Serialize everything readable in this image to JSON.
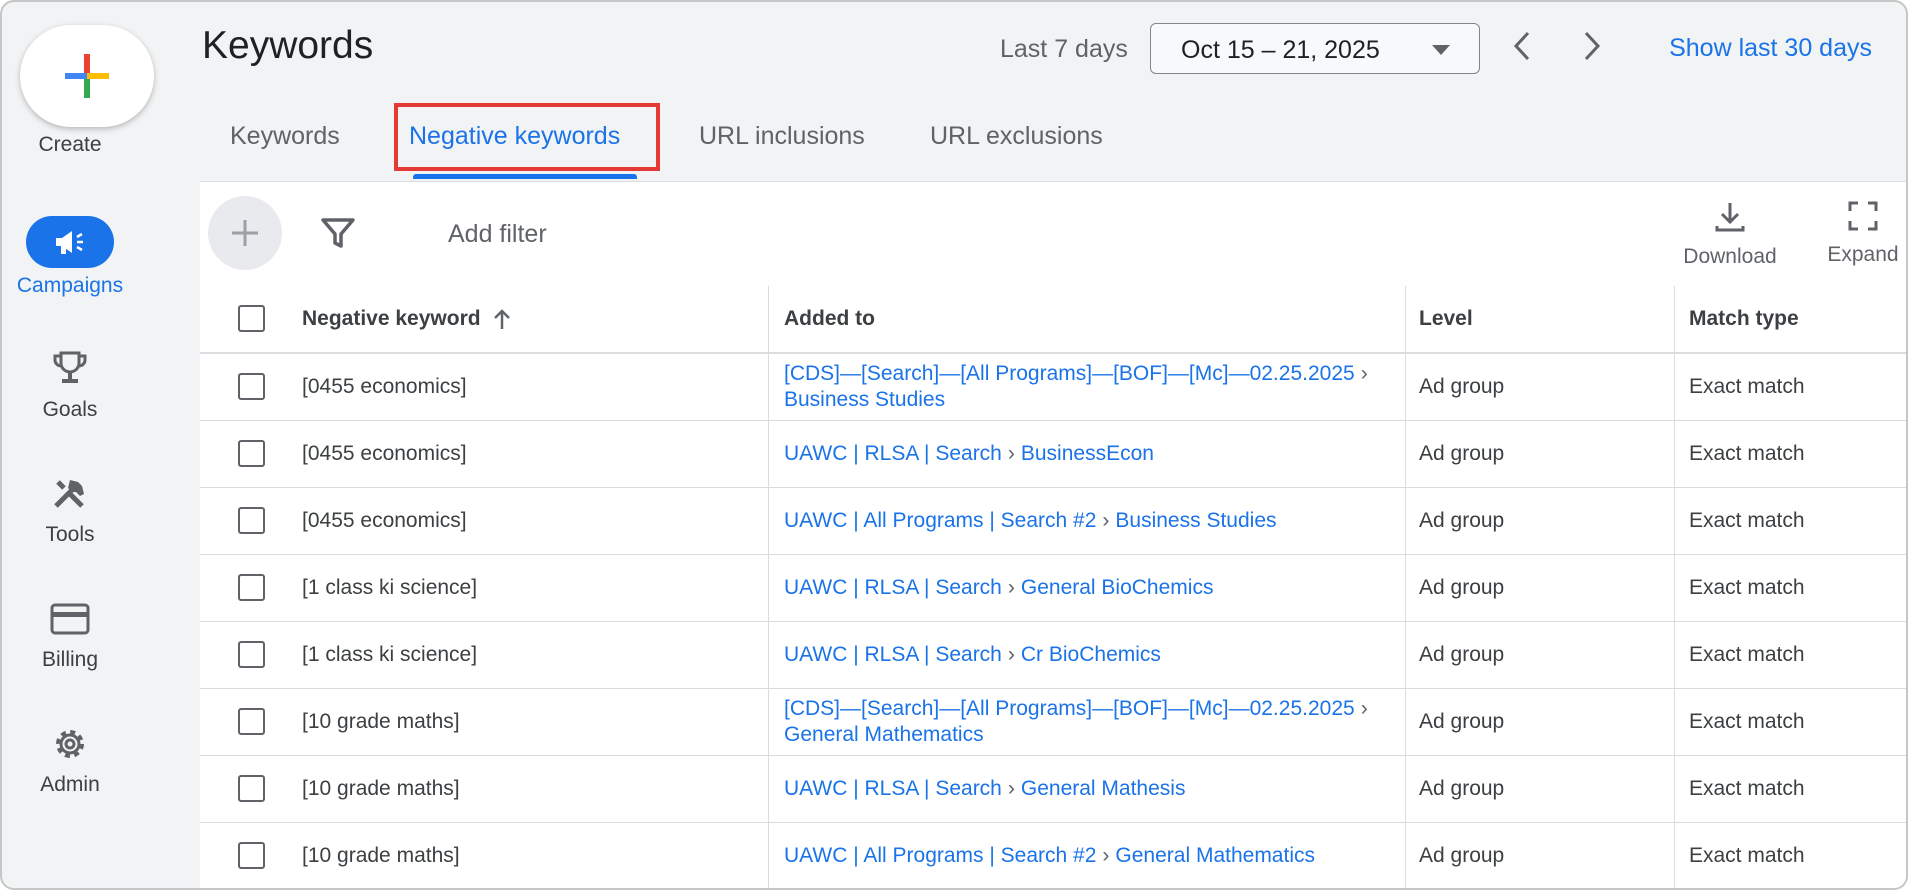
{
  "nav": {
    "create_label": "Create",
    "items": [
      {
        "label": "Campaigns",
        "icon": "megaphone-icon",
        "active": true
      },
      {
        "label": "Goals",
        "icon": "trophy-icon",
        "active": false
      },
      {
        "label": "Tools",
        "icon": "tools-icon",
        "active": false
      },
      {
        "label": "Billing",
        "icon": "credit-card-icon",
        "active": false
      },
      {
        "label": "Admin",
        "icon": "gear-icon",
        "active": false
      }
    ]
  },
  "header": {
    "title": "Keywords",
    "range_label": "Last 7 days",
    "date_range": "Oct 15 – 21, 2025",
    "show_last_30": "Show last 30 days"
  },
  "tabs": [
    {
      "label": "Keywords",
      "active": false
    },
    {
      "label": "Negative keywords",
      "active": true
    },
    {
      "label": "URL inclusions",
      "active": false
    },
    {
      "label": "URL exclusions",
      "active": false
    }
  ],
  "toolbar": {
    "add_filter": "Add filter",
    "download": "Download",
    "expand": "Expand"
  },
  "table": {
    "columns": [
      "Negative keyword",
      "Added to",
      "Level",
      "Match type"
    ],
    "rows": [
      {
        "keyword": "[0455 economics]",
        "campaign": "[CDS]—[Search]—[All Programs]—[BOF]—[Mc]—02.25.2025",
        "ad_group": "Business Studies",
        "level": "Ad group",
        "match": "Exact match",
        "wrap": true
      },
      {
        "keyword": "[0455 economics]",
        "campaign": "UAWC | RLSA | Search",
        "ad_group": "BusinessEcon",
        "level": "Ad group",
        "match": "Exact match",
        "wrap": false
      },
      {
        "keyword": "[0455 economics]",
        "campaign": "UAWC | All Programs | Search #2",
        "ad_group": "Business Studies",
        "level": "Ad group",
        "match": "Exact match",
        "wrap": false
      },
      {
        "keyword": "[1 class ki science]",
        "campaign": "UAWC | RLSA | Search",
        "ad_group": "General BioChemics",
        "level": "Ad group",
        "match": "Exact match",
        "wrap": false
      },
      {
        "keyword": "[1 class ki science]",
        "campaign": "UAWC | RLSA | Search",
        "ad_group": "Cr BioChemics",
        "level": "Ad group",
        "match": "Exact match",
        "wrap": false
      },
      {
        "keyword": "[10 grade maths]",
        "campaign": "[CDS]—[Search]—[All Programs]—[BOF]—[Mc]—02.25.2025",
        "ad_group": "General Mathematics",
        "level": "Ad group",
        "match": "Exact match",
        "wrap": true
      },
      {
        "keyword": "[10 grade maths]",
        "campaign": "UAWC | RLSA | Search",
        "ad_group": "General Mathesis",
        "level": "Ad group",
        "match": "Exact match",
        "wrap": false
      },
      {
        "keyword": "[10 grade maths]",
        "campaign": "UAWC | All Programs | Search #2",
        "ad_group": "General Mathematics",
        "level": "Ad group",
        "match": "Exact match",
        "wrap": false
      }
    ]
  },
  "colors": {
    "accent": "#1a73e8",
    "highlight": "#e53935"
  }
}
